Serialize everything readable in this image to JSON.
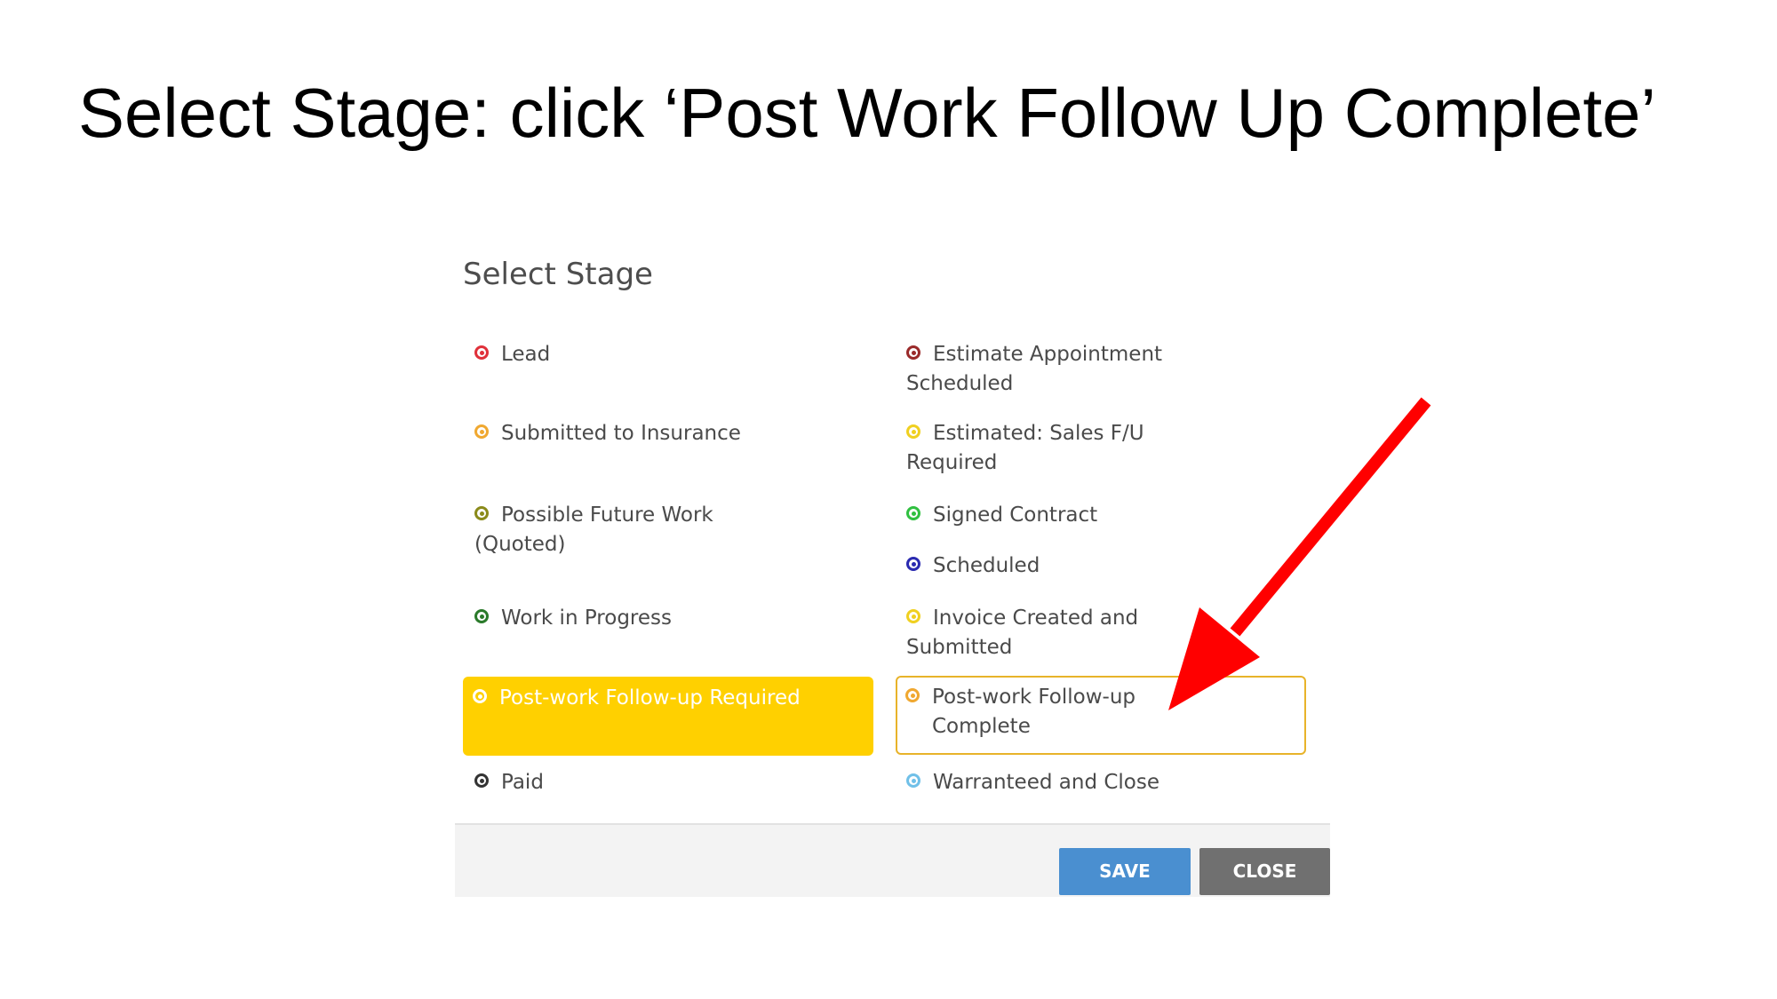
{
  "slide": {
    "title": "Select Stage: click ‘Post Work Follow Up Complete’"
  },
  "dialog": {
    "title": "Select Stage",
    "save_label": "SAVE",
    "close_label": "CLOSE",
    "stages": {
      "lead": {
        "label": "Lead",
        "color": "#e0303a"
      },
      "submitted_to_insurance": {
        "label": "Submitted to Insurance",
        "color": "#f0a830"
      },
      "possible_future_work": {
        "label": "Possible Future Work (Quoted)",
        "color": "#8a8a1a"
      },
      "work_in_progress": {
        "label": "Work in Progress",
        "color": "#2a7a2a"
      },
      "post_work_follow_up_required": {
        "label": "Post-work Follow-up Required",
        "color": "#ffffff",
        "selected": true
      },
      "paid": {
        "label": "Paid",
        "color": "#333333"
      },
      "estimate_appointment_scheduled": {
        "label": "Estimate Appointment Scheduled",
        "color": "#9a2a2a"
      },
      "estimated_sales_fu_required": {
        "label": "Estimated: Sales F/U Required",
        "color": "#f0d020"
      },
      "signed_contract": {
        "label": "Signed Contract",
        "color": "#30c040"
      },
      "scheduled": {
        "label": "Scheduled",
        "color": "#2a2ab0"
      },
      "invoice_created_and_submitted": {
        "label": "Invoice Created and Submitted",
        "color": "#f0d020"
      },
      "post_work_follow_up_complete": {
        "label": "Post-work Follow-up Complete",
        "color": "#f0a830",
        "highlighted": true
      },
      "warranteed_and_close": {
        "label": "Warranteed and Close",
        "color": "#70c0e8"
      }
    }
  },
  "colors": {
    "selected_bg": "#ffd000",
    "highlight_border": "#e8b32a",
    "save_button": "#4a8fd0",
    "close_button": "#707070",
    "arrow": "#ff0000"
  }
}
